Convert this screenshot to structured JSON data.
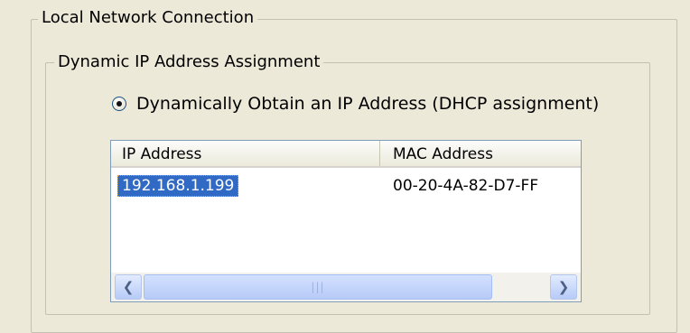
{
  "local_network": {
    "group_title": "Local Network Connection"
  },
  "dynamic_ip": {
    "group_title": "Dynamic IP Address Assignment",
    "radio_label": "Dynamically Obtain an IP Address (DHCP assignment)",
    "radio_selected": true
  },
  "address_list": {
    "columns": [
      "IP Address",
      "MAC Address"
    ],
    "rows": [
      {
        "ip": "192.168.1.199",
        "mac": "00-20-4A-82-D7-FF",
        "selected": true
      }
    ]
  },
  "scrollbar": {
    "left_icon": "chevron-left-icon",
    "right_icon": "chevron-right-icon",
    "grip": "|||"
  },
  "colors": {
    "selection": "#316ac5",
    "dialog_bg": "#ece9d8"
  }
}
